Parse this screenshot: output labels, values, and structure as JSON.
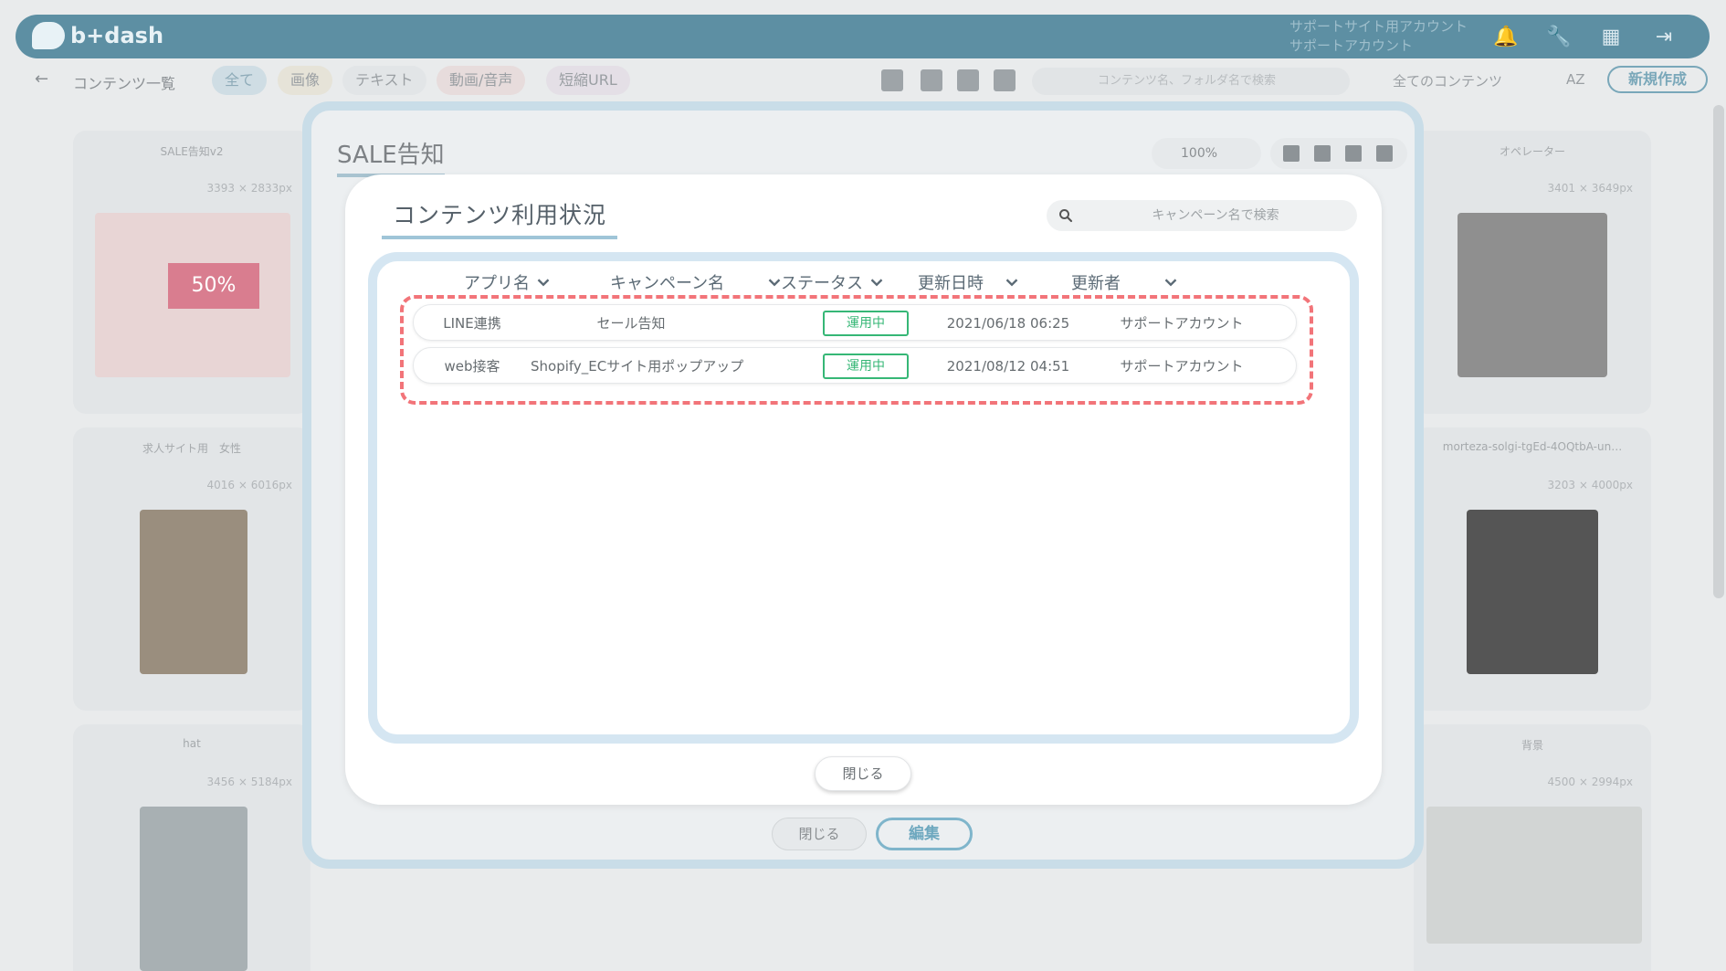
{
  "app": {
    "logo_text": "b+dash"
  },
  "account": {
    "line1": "サポートサイト用アカウント",
    "line2": "サポートアカウント"
  },
  "subbar": {
    "page_title": "コンテンツ一覧",
    "filters": [
      "全て",
      "画像",
      "テキスト",
      "動画/音声",
      "短縮URL"
    ],
    "search_placeholder": "コンテンツ名、フォルダ名で検索",
    "sort_value": "全てのコンテンツ",
    "sort_icon_text": "AZ",
    "new_button": "新規作成"
  },
  "cards": [
    {
      "title": "SALE告知v2",
      "size": "3393 × 2833px"
    },
    {
      "title": "オペレーター",
      "size": "3401 × 3649px"
    },
    {
      "title": "求人サイト用　女性",
      "size": "4016 × 6016px"
    },
    {
      "title": "morteza-solgi-tgEd-4OQtbA-un…",
      "size": "3203 × 4000px"
    },
    {
      "title": "hat",
      "size": "3456 × 5184px"
    },
    {
      "title": "背景",
      "size": "4500 × 2994px"
    }
  ],
  "sale_badge_text": "50%",
  "detail_dialog": {
    "title": "SALE告知",
    "zoom": "100%",
    "close_label": "閉じる",
    "edit_label": "編集"
  },
  "usage_modal": {
    "title": "コンテンツ利用状況",
    "search_placeholder": "キャンペーン名で検索",
    "columns": [
      "アプリ名",
      "キャンペーン名",
      "ステータス",
      "更新日時",
      "更新者"
    ],
    "rows": [
      {
        "app": "LINE連携",
        "campaign": "セール告知",
        "status": "運用中",
        "updated_at": "2021/06/18 06:25",
        "updated_by": "サポートアカウント"
      },
      {
        "app": "web接客",
        "campaign": "Shopify_ECサイト用ポップアップ",
        "status": "運用中",
        "updated_at": "2021/08/12 04:51",
        "updated_by": "サポートアカウント"
      }
    ],
    "close_label": "閉じる"
  },
  "colors": {
    "accent": "#5d8fa3",
    "status_green": "#36b776",
    "highlight_dash": "#f27479",
    "frame": "#d5e6f2"
  }
}
